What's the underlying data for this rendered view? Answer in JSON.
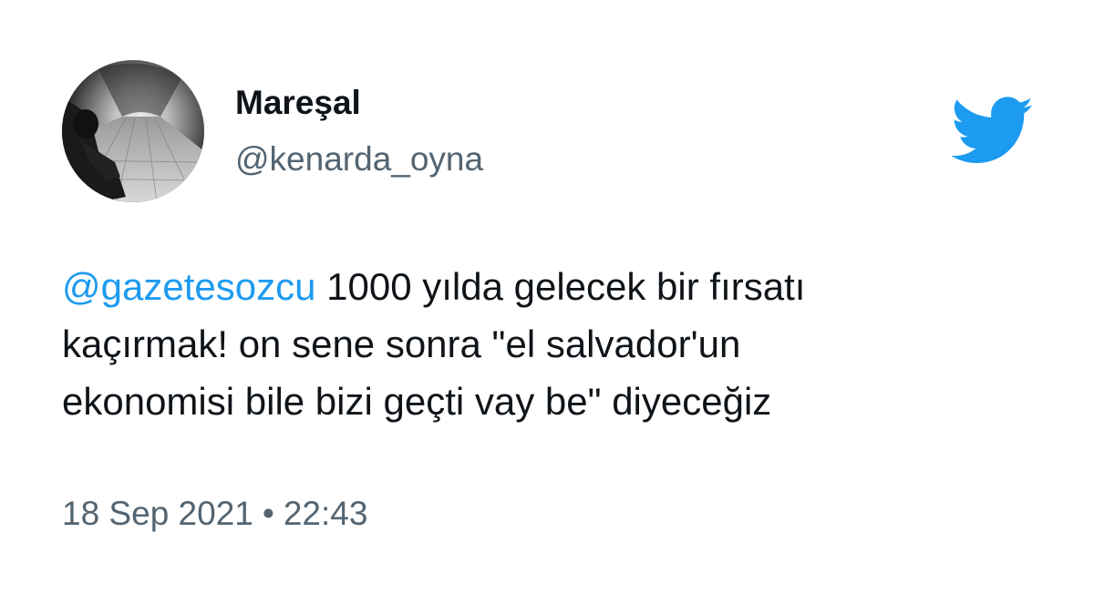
{
  "author": {
    "display_name": "Mareşal",
    "handle": "@kenarda_oyna",
    "avatar_icon": "avatar-photo-tunnel"
  },
  "tweet": {
    "mention": "@gazetesozcu",
    "line1_rest": " 1000 yılda gelecek bir fırsatı",
    "line2": "kaçırmak! on sene sonra \"el salvador'un",
    "line3": "ekonomisi bile bizi geçti vay be\" diyeceğiz"
  },
  "meta": {
    "date": "18 Sep 2021",
    "separator": "•",
    "time": "22:43"
  },
  "brand": {
    "icon": "twitter-bird-icon",
    "color": "#1d9bf0"
  }
}
